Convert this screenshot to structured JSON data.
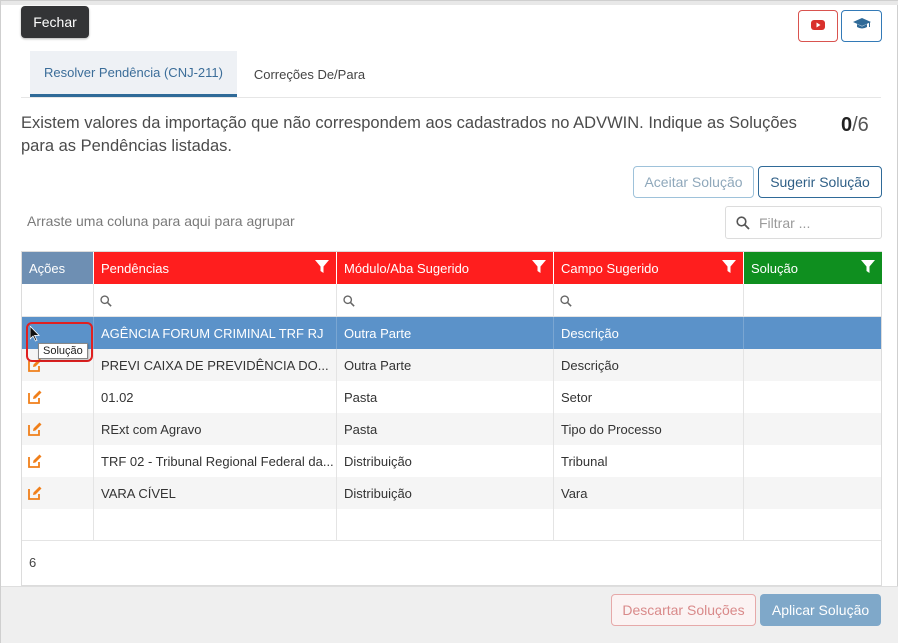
{
  "toolbar": {
    "close_label": "Fechar",
    "video_icon": "youtube-icon",
    "help_icon": "graduation-cap-icon"
  },
  "tabs": [
    {
      "label": "Resolver Pendência (CNJ-211)",
      "active": true
    },
    {
      "label": "Correções De/Para",
      "active": false
    }
  ],
  "message": "Existem valores da importação que não correspondem aos cadastrados no ADVWIN. Indique as Soluções para as Pendências listadas.",
  "counter": {
    "resolved": "0",
    "total": "/6"
  },
  "actions": {
    "accept_label": "Aceitar Solução",
    "suggest_label": "Sugerir Solução"
  },
  "grid": {
    "group_hint": "Arraste uma coluna para aqui para agrupar",
    "filter_placeholder": "Filtrar ...",
    "columns": [
      "Ações",
      "Pendências",
      "Módulo/Aba Sugerido",
      "Campo Sugerido",
      "Solução"
    ],
    "rows": [
      {
        "pendencia": "AGÊNCIA FORUM CRIMINAL TRF RJ",
        "modulo": "Outra Parte",
        "campo": "Descrição",
        "solucao": ""
      },
      {
        "pendencia": "PREVI CAIXA DE PREVIDÊNCIA DO...",
        "modulo": "Outra Parte",
        "campo": "Descrição",
        "solucao": ""
      },
      {
        "pendencia": "01.02",
        "modulo": "Pasta",
        "campo": "Setor",
        "solucao": ""
      },
      {
        "pendencia": "RExt com Agravo",
        "modulo": "Pasta",
        "campo": "Tipo do Processo",
        "solucao": ""
      },
      {
        "pendencia": "TRF 02 - Tribunal Regional Federal da...",
        "modulo": "Distribuição",
        "campo": "Tribunal",
        "solucao": ""
      },
      {
        "pendencia": "VARA CÍVEL",
        "modulo": "Distribuição",
        "campo": "Vara",
        "solucao": ""
      }
    ],
    "footer_count": "6",
    "tooltip": "Solução"
  },
  "bottom": {
    "discard_label": "Descartar Soluções",
    "apply_label": "Aplicar Solução"
  },
  "colors": {
    "header_red": "#ff1e1e",
    "header_green": "#0f8f1f",
    "header_blue": "#6e8fb3",
    "selected_row": "#5b92c9",
    "edit_icon": "#f07f1a"
  }
}
